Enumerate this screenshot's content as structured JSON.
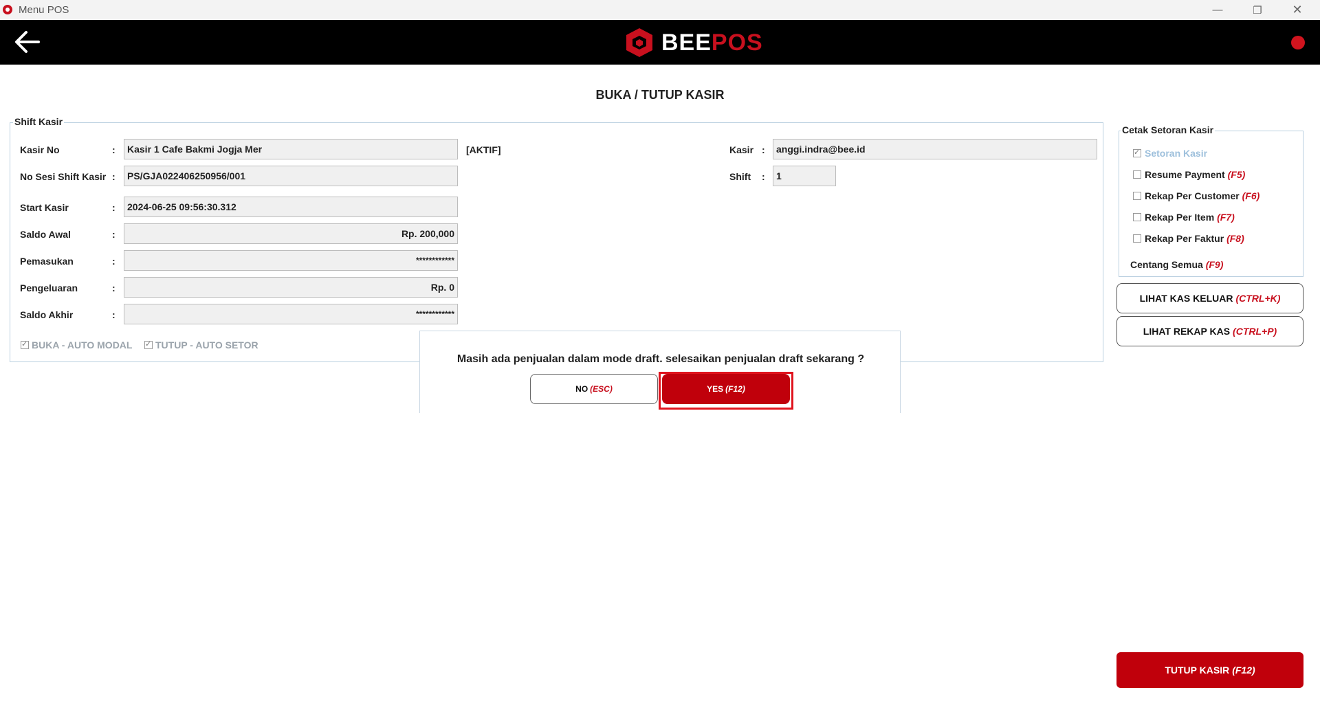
{
  "window": {
    "title": "Menu POS"
  },
  "header": {
    "logo_bee": "BEE",
    "logo_pos": "POS",
    "status_color": "#d0141e"
  },
  "page": {
    "title": "BUKA / TUTUP KASIR"
  },
  "shift": {
    "legend": "Shift Kasir",
    "kasir_no_label": "Kasir No",
    "kasir_no_value": "Kasir 1 Cafe Bakmi Jogja Mer",
    "status": "[AKTIF]",
    "sesi_label": "No Sesi Shift Kasir",
    "sesi_value": "PS/GJA022406250956/001",
    "start_label": "Start Kasir",
    "start_value": "2024-06-25 09:56:30.312",
    "saldo_awal_label": "Saldo Awal",
    "saldo_awal_value": "Rp. 200,000",
    "pemasukan_label": "Pemasukan",
    "pemasukan_value": "************",
    "pengeluaran_label": "Pengeluaran",
    "pengeluaran_value": "Rp. 0",
    "saldo_akhir_label": "Saldo Akhir",
    "saldo_akhir_value": "************",
    "kasir_label": "Kasir",
    "kasir_value": "anggi.indra@bee.id",
    "shift_label": "Shift",
    "shift_value": "1",
    "colon": ":",
    "buka_auto": {
      "label": "BUKA - AUTO MODAL",
      "checked": true
    },
    "tutup_auto": {
      "label": "TUTUP - AUTO SETOR",
      "checked": true
    }
  },
  "cetak": {
    "legend": "Cetak Setoran Kasir",
    "setoran": {
      "label": "Setoran Kasir",
      "checked": true
    },
    "resume": {
      "label": "Resume Payment",
      "key": "(F5)",
      "checked": false
    },
    "customer": {
      "label": "Rekap Per Customer",
      "key": "(F6)",
      "checked": false
    },
    "item": {
      "label": "Rekap Per Item",
      "key": "(F7)",
      "checked": false
    },
    "faktur": {
      "label": "Rekap Per Faktur",
      "key": "(F8)",
      "checked": false
    },
    "centang": {
      "label": "Centang Semua",
      "key": "(F9)"
    }
  },
  "buttons": {
    "kas_keluar": {
      "label": "LIHAT KAS KELUAR",
      "key": "(CTRL+K)"
    },
    "rekap_kas": {
      "label": "LIHAT REKAP KAS",
      "key": "(CTRL+P)"
    },
    "tutup_kasir": {
      "label": "TUTUP KASIR",
      "key": "(F12)"
    }
  },
  "dialog": {
    "message": "Masih ada penjualan dalam mode draft. selesaikan penjualan draft sekarang ?",
    "no": {
      "label": "NO",
      "key": "(ESC)"
    },
    "yes": {
      "label": "YES",
      "key": "(F12)"
    }
  },
  "colors": {
    "accent": "#c0000b",
    "header_bg": "#000000"
  }
}
